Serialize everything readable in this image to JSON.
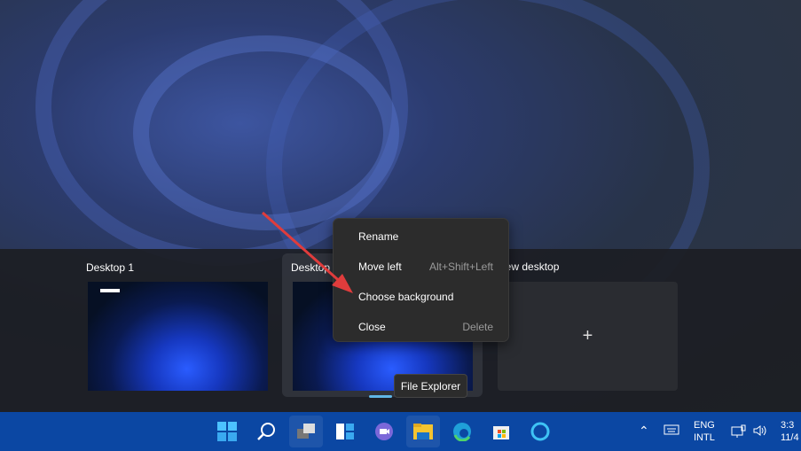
{
  "task_view": {
    "desktops": [
      {
        "label": "Desktop 1"
      },
      {
        "label": "Desktop 2"
      }
    ],
    "new_desktop_label": "New desktop",
    "new_desktop_plus": "+"
  },
  "context_menu": {
    "items": [
      {
        "label": "Rename",
        "shortcut": ""
      },
      {
        "label": "Move left",
        "shortcut": "Alt+Shift+Left"
      },
      {
        "label": "Choose background",
        "shortcut": ""
      },
      {
        "label": "Close",
        "shortcut": "Delete"
      }
    ]
  },
  "tooltip": "File Explorer",
  "taskbar": {
    "apps": [
      "start-icon",
      "search-icon",
      "task-view-icon",
      "widgets-icon",
      "teams-chat-icon",
      "file-explorer-icon",
      "edge-icon",
      "store-icon",
      "cortana-icon"
    ],
    "tray": {
      "lang1": "ENG",
      "lang2": "INTL",
      "time": "3:3",
      "date": "11/4"
    }
  },
  "colors": {
    "taskbar": "#0b47a3",
    "arrow": "#e03c3c",
    "accent": "#5fb6e6"
  }
}
